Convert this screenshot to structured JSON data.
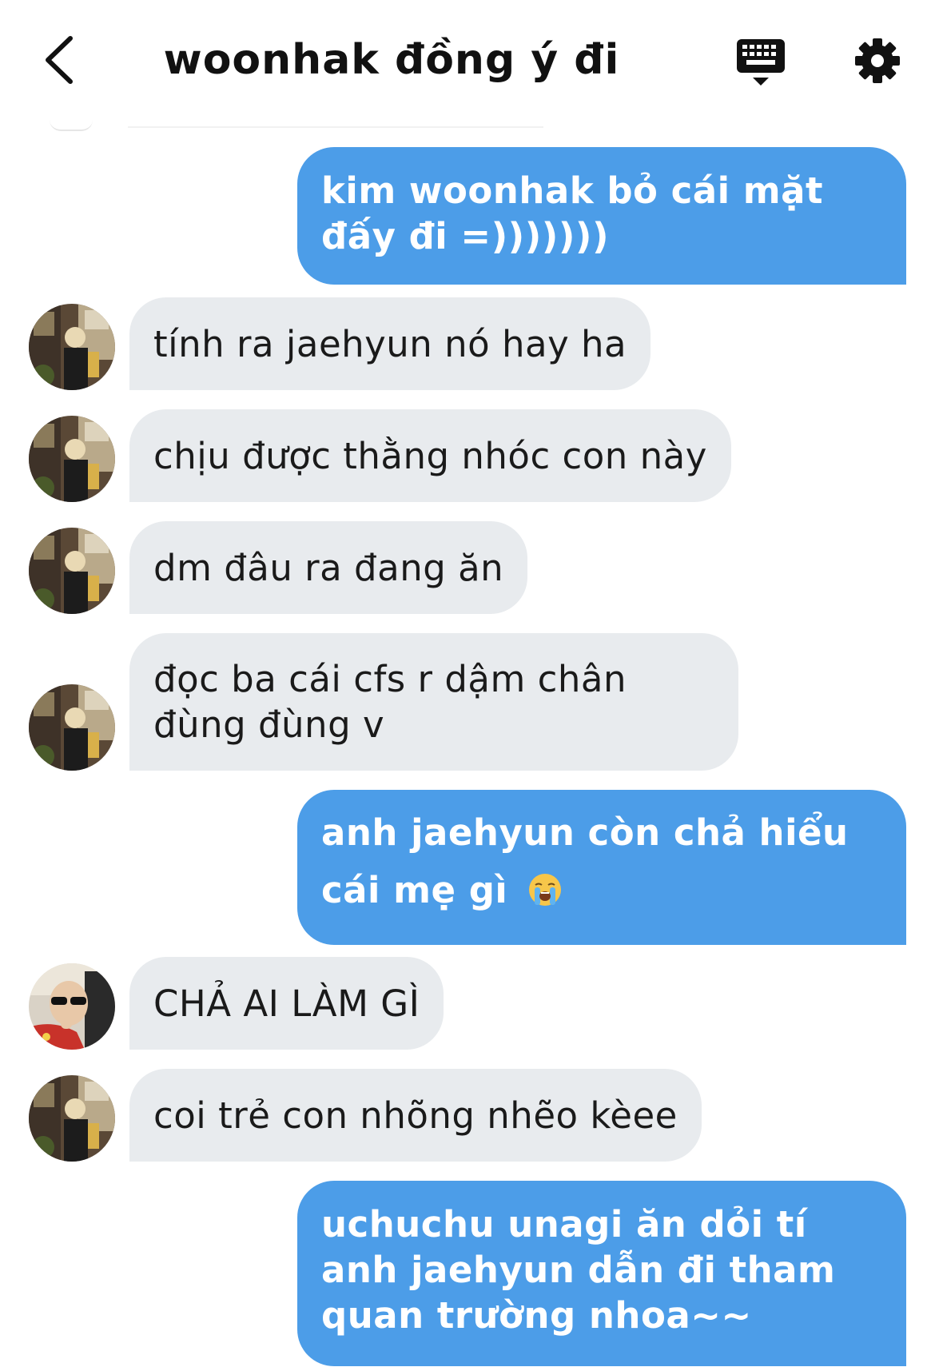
{
  "header": {
    "title": "woonhak đồng ý đi",
    "back_icon": "chevron-left-icon",
    "keyboard_icon": "keyboard-icon",
    "settings_icon": "gear-icon"
  },
  "colors": {
    "sent_bubble": "#4c9de8",
    "received_bubble": "#e8ebee"
  },
  "messages": [
    {
      "side": "sent",
      "text": "kim woonhak bỏ cái mặt đấy đi =)))))))"
    },
    {
      "side": "received",
      "avatar": "photo-street-avatar",
      "text": "tính ra jaehyun nó hay ha"
    },
    {
      "side": "received",
      "avatar": "photo-street-avatar",
      "text": "chịu được thằng nhóc con này"
    },
    {
      "side": "received",
      "avatar": "photo-street-avatar",
      "text": "dm đâu ra đang ăn"
    },
    {
      "side": "received",
      "avatar": "photo-street-avatar",
      "text": "đọc ba cái cfs r dậm chân đùng đùng v"
    },
    {
      "side": "sent",
      "text": "anh jaehyun còn chả hiểu cái mẹ gì",
      "emoji": "loudly-crying-face-emoji"
    },
    {
      "side": "received",
      "avatar": "photo-sunglasses-avatar",
      "text": "CHẢ AI LÀM GÌ"
    },
    {
      "side": "received",
      "avatar": "photo-street-avatar",
      "text": "coi trẻ con nhõng nhẽo kèee"
    },
    {
      "side": "sent",
      "text": "uchuchu unagi ăn dỏi tí anh jaehyun dẫn đi tham quan trường nhoa~~"
    }
  ]
}
